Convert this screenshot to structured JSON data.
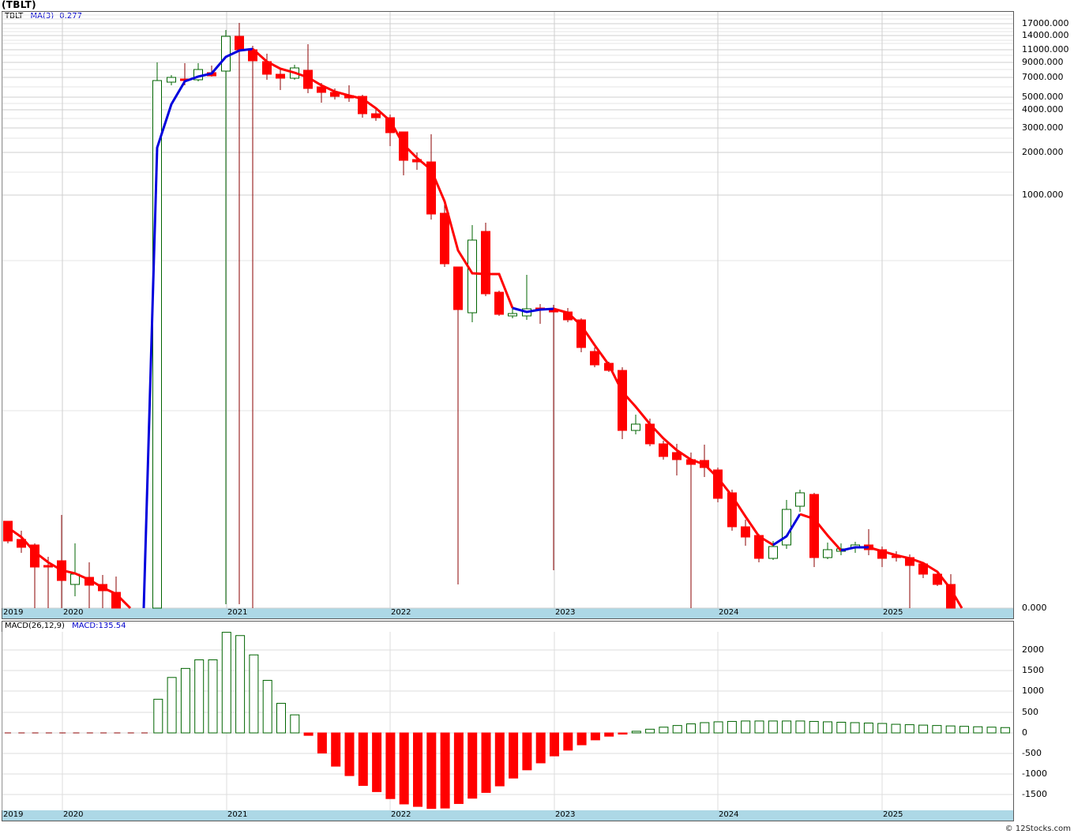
{
  "header": {
    "title": "(TBLT)"
  },
  "price_legend": {
    "symbol": "TBLT",
    "ma_label": "MA(3)",
    "ma_value": "0.277"
  },
  "macd_legend": {
    "label": "MACD(26,12,9)",
    "value_label": "MACD:135.54"
  },
  "copyright": "© 12Stocks.com",
  "colors": {
    "up": "#006400",
    "down": "#ff0000",
    "wick_down": "#8b0000",
    "ma_up": "#0000dd",
    "ma_down": "#ff0000",
    "strip": "#add8e6"
  },
  "chart_data": [
    {
      "type": "candlestick",
      "title": "(TBLT)",
      "x_tick_labels": [
        "2019",
        "2020",
        "2021",
        "2022",
        "2023",
        "2024",
        "2025"
      ],
      "y_tick_labels": [
        "17000.000",
        "14000.000",
        "11000.000",
        "9000.000",
        "7000.000",
        "5000.000",
        "4000.000",
        "3000.000",
        "2000.000",
        "1000.000",
        "0.000"
      ],
      "y_scale": "log",
      "grid": true,
      "series": [
        {
          "name": "MA(3)",
          "type": "line"
        }
      ]
    },
    {
      "type": "bar",
      "title": "MACD(26,12,9)",
      "x_tick_labels": [
        "2019",
        "2020",
        "2021",
        "2022",
        "2023",
        "2024",
        "2025"
      ],
      "y_tick_labels": [
        "2000",
        "1500",
        "1000",
        "500",
        "0",
        "-500",
        "-1000",
        "-1500"
      ],
      "ylim": [
        -1850,
        2450
      ],
      "values": [
        0,
        0,
        0,
        0,
        0,
        0,
        0,
        0,
        0,
        0,
        0,
        820,
        1350,
        1570,
        1780,
        1780,
        2450,
        2370,
        1900,
        1280,
        720,
        440,
        -60,
        -490,
        -810,
        -1040,
        -1280,
        -1430,
        -1600,
        -1730,
        -1790,
        -1840,
        -1830,
        -1720,
        -1590,
        -1450,
        -1290,
        -1100,
        -900,
        -730,
        -560,
        -420,
        -290,
        -170,
        -80,
        -20,
        40,
        90,
        140,
        180,
        220,
        250,
        270,
        280,
        290,
        290,
        290,
        290,
        290,
        280,
        270,
        260,
        250,
        240,
        230,
        210,
        200,
        190,
        180,
        170,
        160,
        150,
        140,
        130
      ]
    }
  ]
}
